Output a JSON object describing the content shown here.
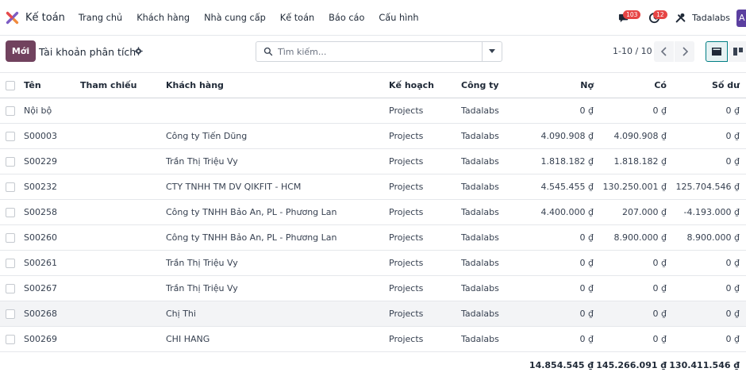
{
  "nav": {
    "app_name": "Kế toán",
    "menu": [
      "Trang chủ",
      "Khách hàng",
      "Nhà cung cấp",
      "Kế toán",
      "Báo cáo",
      "Cấu hình"
    ],
    "messages_badge": "103",
    "activities_badge": "12",
    "company": "Tadalabs",
    "avatar_letter": "A"
  },
  "control": {
    "new_label": "Mới",
    "title": "Tài khoản phân tích",
    "search_placeholder": "Tìm kiếm...",
    "pager": "1-10 / 10"
  },
  "table": {
    "columns": [
      "Tên",
      "Tham chiếu",
      "Khách hàng",
      "Kế hoạch",
      "Công ty",
      "Nợ",
      "Có",
      "Số dư"
    ],
    "rows": [
      {
        "name": "Nội bộ",
        "ref": "",
        "customer": "",
        "plan": "Projects",
        "company": "Tadalabs",
        "debit": "0 ₫",
        "credit": "0 ₫",
        "balance": "0 ₫"
      },
      {
        "name": "S00003",
        "ref": "",
        "customer": "Công ty Tiến Dũng",
        "plan": "Projects",
        "company": "Tadalabs",
        "debit": "4.090.908 ₫",
        "credit": "4.090.908 ₫",
        "balance": "0 ₫"
      },
      {
        "name": "S00229",
        "ref": "",
        "customer": "Trần Thị Triệu Vy",
        "plan": "Projects",
        "company": "Tadalabs",
        "debit": "1.818.182 ₫",
        "credit": "1.818.182 ₫",
        "balance": "0 ₫"
      },
      {
        "name": "S00232",
        "ref": "",
        "customer": "CTY TNHH TM DV QIKFIT - HCM",
        "plan": "Projects",
        "company": "Tadalabs",
        "debit": "4.545.455 ₫",
        "credit": "130.250.001 ₫",
        "balance": "125.704.546 ₫"
      },
      {
        "name": "S00258",
        "ref": "",
        "customer": "Công ty TNHH Bảo An, PL - Phương Lan",
        "plan": "Projects",
        "company": "Tadalabs",
        "debit": "4.400.000 ₫",
        "credit": "207.000 ₫",
        "balance": "-4.193.000 ₫"
      },
      {
        "name": "S00260",
        "ref": "",
        "customer": "Công ty TNHH Bảo An, PL - Phương Lan",
        "plan": "Projects",
        "company": "Tadalabs",
        "debit": "0 ₫",
        "credit": "8.900.000 ₫",
        "balance": "8.900.000 ₫"
      },
      {
        "name": "S00261",
        "ref": "",
        "customer": "Trần Thị Triệu Vy",
        "plan": "Projects",
        "company": "Tadalabs",
        "debit": "0 ₫",
        "credit": "0 ₫",
        "balance": "0 ₫"
      },
      {
        "name": "S00267",
        "ref": "",
        "customer": "Trần Thị Triệu Vy",
        "plan": "Projects",
        "company": "Tadalabs",
        "debit": "0 ₫",
        "credit": "0 ₫",
        "balance": "0 ₫"
      },
      {
        "name": "S00268",
        "ref": "",
        "customer": "Chị Thi",
        "plan": "Projects",
        "company": "Tadalabs",
        "debit": "0 ₫",
        "credit": "0 ₫",
        "balance": "0 ₫"
      },
      {
        "name": "S00269",
        "ref": "",
        "customer": "CHI HANG",
        "plan": "Projects",
        "company": "Tadalabs",
        "debit": "0 ₫",
        "credit": "0 ₫",
        "balance": "0 ₫"
      }
    ],
    "totals": {
      "debit": "14.854.545 ₫",
      "credit": "145.266.091 ₫",
      "balance": "130.411.546 ₫"
    }
  },
  "colors": {
    "primary": "#71425e",
    "accent": "#017e84",
    "badge": "#e64545"
  }
}
